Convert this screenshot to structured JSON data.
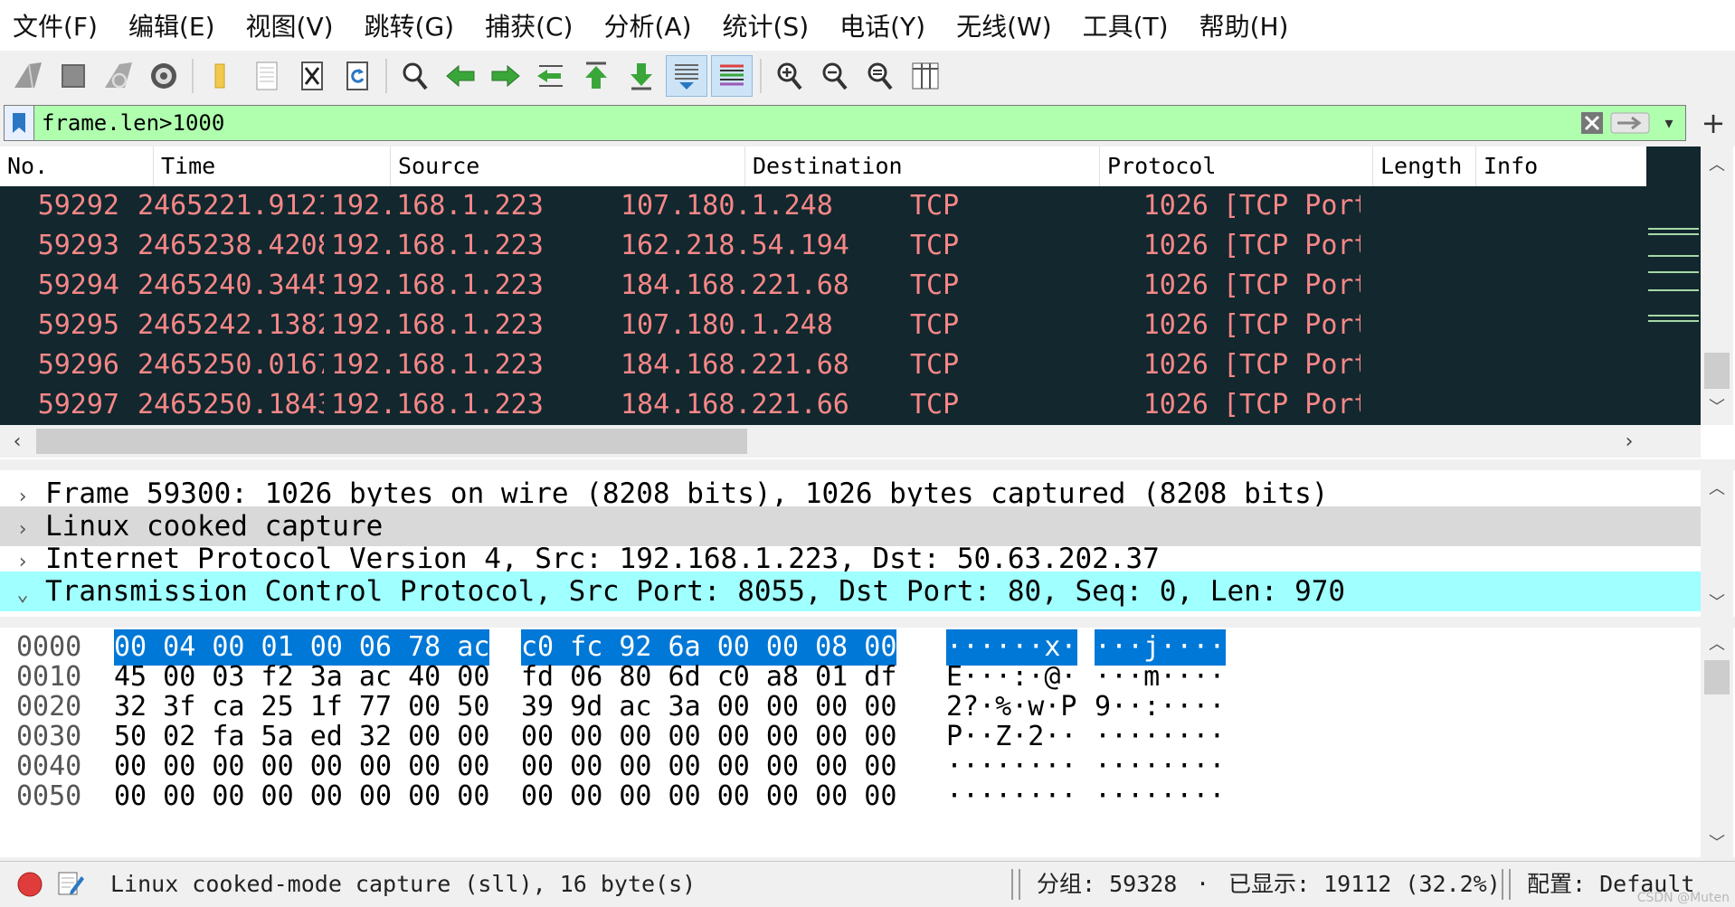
{
  "menu": [
    "文件(F)",
    "编辑(E)",
    "视图(V)",
    "跳转(G)",
    "捕获(C)",
    "分析(A)",
    "统计(S)",
    "电话(Y)",
    "无线(W)",
    "工具(T)",
    "帮助(H)"
  ],
  "toolbar": {
    "icons": [
      "shark-start-icon",
      "stop-square-icon",
      "shark-restart-icon",
      "gear-options-icon",
      "folder-open-icon",
      "file-save-icon",
      "file-close-icon",
      "reload-icon",
      "search-icon",
      "arrow-back-icon",
      "arrow-forward-icon",
      "goto-packet-icon",
      "first-packet-icon",
      "last-packet-icon",
      "autoscroll-icon",
      "colorize-icon",
      "zoom-in-icon",
      "zoom-out-icon",
      "zoom-normal-icon",
      "resize-columns-icon"
    ],
    "colors": {
      "green": "#3aa63a",
      "blue": "#2b78c2"
    }
  },
  "filter": {
    "value": "frame.len>1000",
    "background": "#afffaf"
  },
  "packet_list": {
    "columns": [
      "No.",
      "Time",
      "Source",
      "Destination",
      "Protocol",
      "Length",
      "Info"
    ],
    "rows": [
      {
        "no": "59292",
        "time": "2465221.9121…",
        "src": "192.168.1.223",
        "dst": "107.180.1.248",
        "proto": "TCP",
        "len": "1026",
        "info": "[TCP Port"
      },
      {
        "no": "59293",
        "time": "2465238.4208…",
        "src": "192.168.1.223",
        "dst": "162.218.54.194",
        "proto": "TCP",
        "len": "1026",
        "info": "[TCP Port"
      },
      {
        "no": "59294",
        "time": "2465240.3445…",
        "src": "192.168.1.223",
        "dst": "184.168.221.68",
        "proto": "TCP",
        "len": "1026",
        "info": "[TCP Port"
      },
      {
        "no": "59295",
        "time": "2465242.1382…",
        "src": "192.168.1.223",
        "dst": "107.180.1.248",
        "proto": "TCP",
        "len": "1026",
        "info": "[TCP Port"
      },
      {
        "no": "59296",
        "time": "2465250.0167…",
        "src": "192.168.1.223",
        "dst": "184.168.221.68",
        "proto": "TCP",
        "len": "1026",
        "info": "[TCP Port"
      },
      {
        "no": "59297",
        "time": "2465250.1843…",
        "src": "192.168.1.223",
        "dst": "184.168.221.66",
        "proto": "TCP",
        "len": "1026",
        "info": "[TCP Port"
      }
    ],
    "row_bg": "#12272e",
    "row_fg": "#f78787"
  },
  "details": [
    {
      "label": "Frame 59300: 1026 bytes on wire (8208 bits), 1026 bytes captured (8208 bits)",
      "expanded": false
    },
    {
      "label": "Linux cooked capture",
      "expanded": false
    },
    {
      "label": "Internet Protocol Version 4, Src: 192.168.1.223, Dst: 50.63.202.37",
      "expanded": false
    },
    {
      "label": "Transmission Control Protocol, Src Port: 8055, Dst Port: 80, Seq: 0, Len: 970",
      "expanded": true
    }
  ],
  "bytes": [
    {
      "offset": "0000",
      "hex_a": "00 04 00 01 00 06 78 ac",
      "hex_b": "c0 fc 92 6a 00 00 08 00",
      "ascii_a": "······x·",
      "ascii_b": "···j····"
    },
    {
      "offset": "0010",
      "hex_a": "45 00 03 f2 3a ac 40 00",
      "hex_b": "fd 06 80 6d c0 a8 01 df",
      "ascii_a": "E···:·@·",
      "ascii_b": "···m····"
    },
    {
      "offset": "0020",
      "hex_a": "32 3f ca 25 1f 77 00 50",
      "hex_b": "39 9d ac 3a 00 00 00 00",
      "ascii_a": "2?·%·w·P",
      "ascii_b": "9··:····"
    },
    {
      "offset": "0030",
      "hex_a": "50 02 fa 5a ed 32 00 00",
      "hex_b": "00 00 00 00 00 00 00 00",
      "ascii_a": "P··Z·2··",
      "ascii_b": "········"
    },
    {
      "offset": "0040",
      "hex_a": "00 00 00 00 00 00 00 00",
      "hex_b": "00 00 00 00 00 00 00 00",
      "ascii_a": "········",
      "ascii_b": "········"
    },
    {
      "offset": "0050",
      "hex_a": "00 00 00 00 00 00 00 00",
      "hex_b": "00 00 00 00 00 00 00 00",
      "ascii_a": "········",
      "ascii_b": "········"
    }
  ],
  "status": {
    "capture_desc": "Linux cooked-mode capture (sll), 16 byte(s)",
    "packets": "分组: 59328",
    "bullet": "·",
    "displayed": "已显示: 19112 (32.2%)",
    "profile": "配置: Default",
    "watermark": "CSDN @Muten"
  }
}
